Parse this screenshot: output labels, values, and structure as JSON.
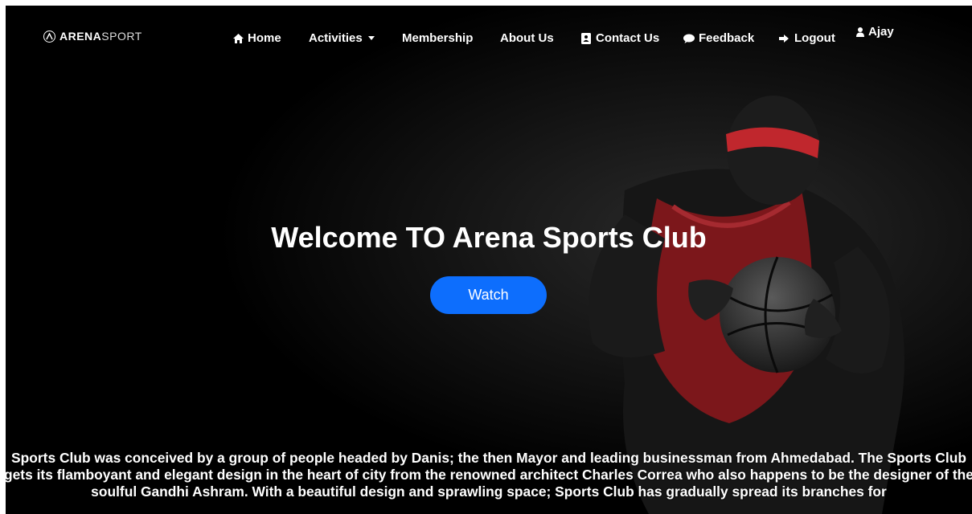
{
  "brand": {
    "bold": "ARENA",
    "light": "SPORT",
    "logo_icon": "arena-logo-icon"
  },
  "nav": {
    "home": {
      "label": "Home",
      "icon": "home-icon"
    },
    "activities": {
      "label": "Activities",
      "icon": "chevron-down-icon"
    },
    "membership": {
      "label": "Membership"
    },
    "about": {
      "label": "About Us"
    },
    "contact": {
      "label": "Contact Us",
      "icon": "contact-book-icon"
    },
    "feedback": {
      "label": "Feedback",
      "icon": "comment-icon"
    },
    "logout": {
      "label": "Logout",
      "icon": "sign-out-icon"
    },
    "user": {
      "label": "Ajay",
      "icon": "user-icon"
    }
  },
  "hero": {
    "title": "Welcome TO Arena Sports Club",
    "watch_label": "Watch"
  },
  "description": "Sports Club was conceived by a group of people headed by Danis; the then Mayor and leading businessman from Ahmedabad. The Sports Club gets its flamboyant and elegant design in the heart of city from the renowned architect Charles Correa who also happens to be the designer of the soulful Gandhi Ashram. With a beautiful design and sprawling space; Sports Club has gradually spread its branches for",
  "colors": {
    "accent": "#0d6efd",
    "background": "#000000",
    "text": "#ffffff",
    "headband": "#c0272d",
    "jersey": "#8b1a1f"
  }
}
